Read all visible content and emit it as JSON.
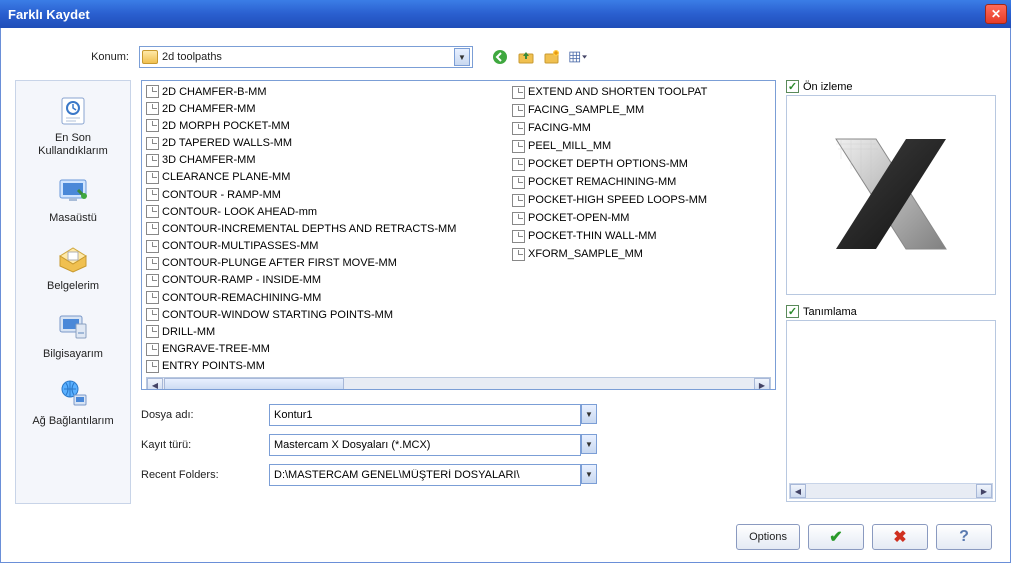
{
  "title": "Farklı Kaydet",
  "location": {
    "label": "Konum:",
    "value": "2d toolpaths"
  },
  "toolbar_icons": [
    "back",
    "up",
    "new-folder",
    "view-mode"
  ],
  "sidebar": {
    "items": [
      {
        "label": "En Son Kullandıklarım",
        "icon": "recent"
      },
      {
        "label": "Masaüstü",
        "icon": "desktop"
      },
      {
        "label": "Belgelerim",
        "icon": "documents"
      },
      {
        "label": "Bilgisayarım",
        "icon": "computer"
      },
      {
        "label": "Ağ Bağlantılarım",
        "icon": "network"
      }
    ]
  },
  "files": {
    "col1": [
      "2D CHAMFER-B-MM",
      "2D CHAMFER-MM",
      "2D MORPH POCKET-MM",
      "2D TAPERED WALLS-MM",
      "3D CHAMFER-MM",
      "CLEARANCE PLANE-MM",
      "CONTOUR - RAMP-MM",
      "CONTOUR- LOOK AHEAD-mm",
      "CONTOUR-INCREMENTAL DEPTHS AND RETRACTS-MM",
      "CONTOUR-MULTIPASSES-MM",
      "CONTOUR-PLUNGE AFTER FIRST MOVE-MM",
      "CONTOUR-RAMP - INSIDE-MM",
      "CONTOUR-REMACHINING-MM",
      "CONTOUR-WINDOW STARTING POINTS-MM",
      "DRILL-MM",
      "ENGRAVE-TREE-MM",
      "ENTRY POINTS-MM"
    ],
    "col2": [
      "EXTEND AND SHORTEN TOOLPAT",
      "FACING_SAMPLE_MM",
      "FACING-MM",
      "PEEL_MILL_MM",
      "POCKET DEPTH OPTIONS-MM",
      "POCKET REMACHINING-MM",
      "POCKET-HIGH SPEED LOOPS-MM",
      "POCKET-OPEN-MM",
      "POCKET-THIN WALL-MM",
      "XFORM_SAMPLE_MM"
    ]
  },
  "form": {
    "filename_label": "Dosya adı:",
    "filename_value": "Kontur1",
    "filetype_label": "Kayıt türü:",
    "filetype_value": "Mastercam X Dosyaları (*.MCX)",
    "recent_label": "Recent Folders:",
    "recent_value": "D:\\MASTERCAM GENEL\\MÜŞTERİ DOSYALARI\\"
  },
  "right": {
    "preview_label": "Ön izleme",
    "description_label": "Tanımlama"
  },
  "buttons": {
    "options": "Options"
  }
}
